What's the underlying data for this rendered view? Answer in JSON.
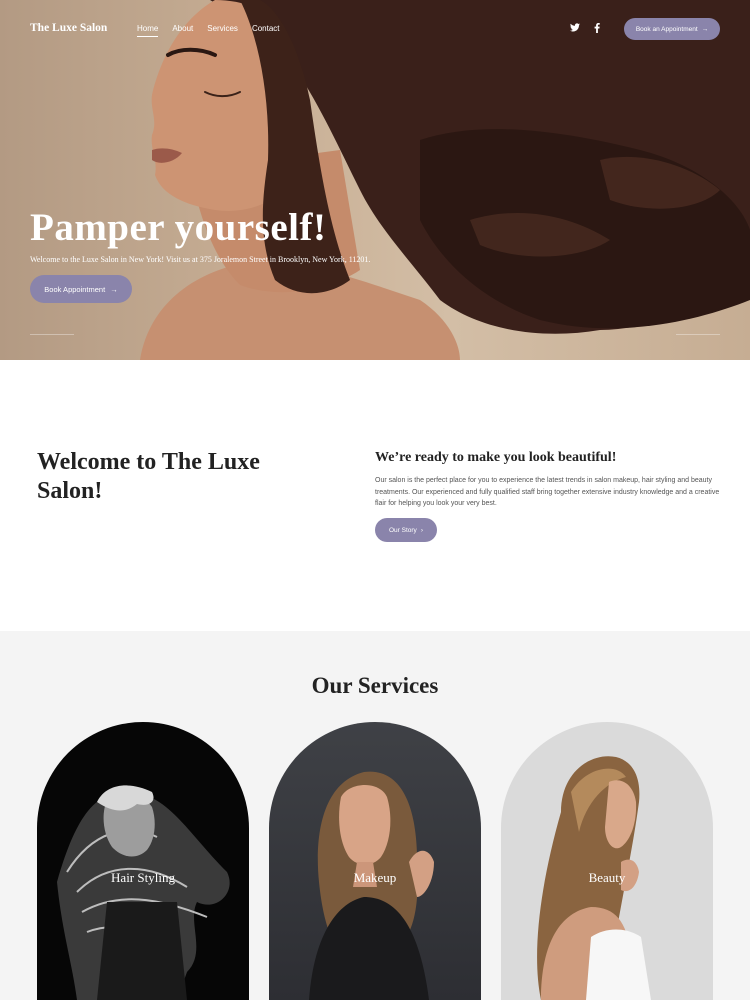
{
  "nav": {
    "brand": "The Luxe Salon",
    "menu": [
      {
        "label": "Home",
        "active": true
      },
      {
        "label": "About"
      },
      {
        "label": "Services"
      },
      {
        "label": "Contact"
      }
    ],
    "social": {
      "twitter": "twitter-icon",
      "facebook": "facebook-icon"
    },
    "cta_label": "Book an Appointment"
  },
  "hero": {
    "title": "Pamper yourself!",
    "subtitle": "Welcome to the Luxe Salon in New York! Visit us at 375 Joralemon Street in Brooklyn, New York, 11201.",
    "button_label": "Book Appointment"
  },
  "welcome": {
    "title": "Welcome to The Luxe Salon!",
    "heading": "We’re ready to make you look beautiful!",
    "text": "Our salon is the perfect place for you to experience the latest trends in salon makeup, hair styling and beauty treatments. Our experienced and fully qualified staff bring together extensive industry knowledge and a creative flair for helping you look your very best.",
    "button_label": "Our Story"
  },
  "services": {
    "title": "Our Services",
    "items": [
      {
        "label": "Hair Styling"
      },
      {
        "label": "Makeup"
      },
      {
        "label": "Beauty"
      }
    ]
  },
  "colors": {
    "accent": "#8a84ab",
    "services_bg": "#f4f4f4",
    "hero_bg": "#c9b096"
  }
}
